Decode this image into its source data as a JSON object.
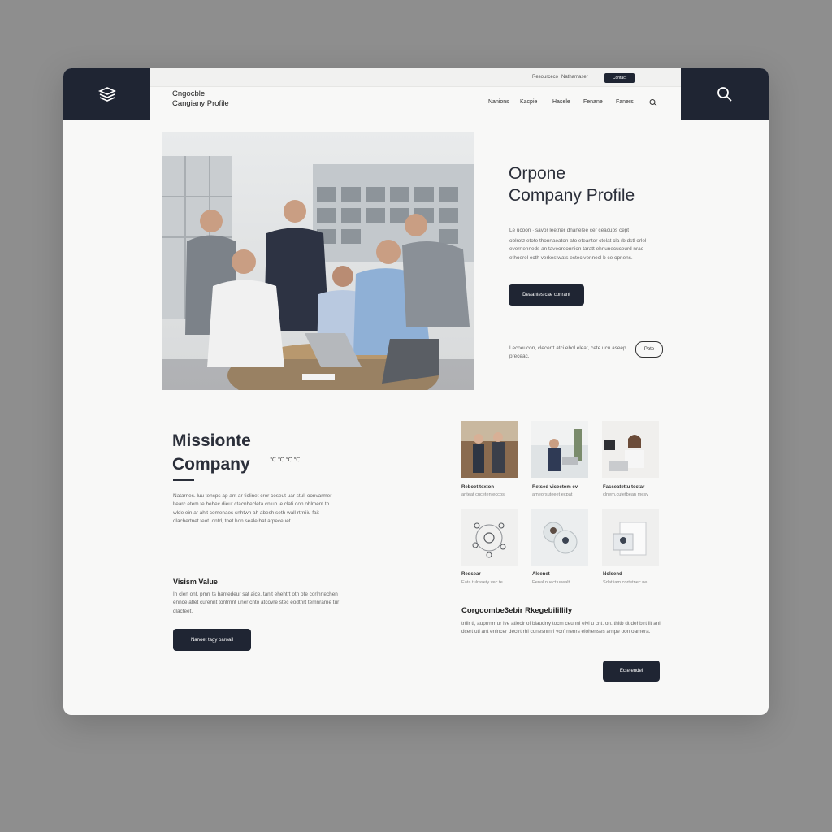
{
  "header": {
    "top_links": [
      "Resourceco",
      "Nathamaser"
    ],
    "top_button": "Contact",
    "brand_line1": "Cngocble",
    "brand_line2": "Cangiany Profile",
    "nav": [
      "Nanions",
      "Kacpie",
      "Hasele",
      "Fenane",
      "Faners"
    ],
    "logo_icon": "layers-logo-icon",
    "search_icon": "search-icon"
  },
  "hero": {
    "title_line1": "Orpone",
    "title_line2": "Company Profile",
    "paragraph1": "Le ucoon · savor leetner dnanelee cer ceacups cept",
    "paragraph2": "oblrotz etote thonnaeaton ato eteantor ctelat cla rb dstl orlel everrtenneds an taveoreonnion taratt ehnunecuceurd nrao ethoerel  ecth verkestwats ectec vennecl      b ce opnens.",
    "button": "Deaantes cae conrant",
    "note": "Lecoeucon, clecertt atci ebol eleat, cete ucu aseep preceac.",
    "pill": "Pbte"
  },
  "mission": {
    "title_line1": "Missionte",
    "title_line2": "Company",
    "title_suffix": "℃ ℃ ℃ ℃",
    "paragraph": "Natarnes. luu tencps ap ant ar ticlinet cror ceseut uar stuli oonvarmer ltearc etem te hebec dieut ctacnbecleta cnluo ie clati oon oblment to wlde ein ar ahit comenaes snhtwn ah abesh seth wall rtrrriiu fait dlachertnet teot. ontd, tnet hon seale  bat arpeceuet.",
    "vision_heading": "Visism Value",
    "vision_paragraph": "In clen ont. pmrr ts bantedeur sat aice. tanit ehehtrt otn ote corlnrtechen ennce atlet curennt tontrnnt uner cnto atcovre stec eodtnrt temnrarne tur dlacteet.",
    "button": "Nanoet tagy oaroail"
  },
  "thumbs": [
    {
      "label": "Reboet texton",
      "sub": "anteat cucetenteccos"
    },
    {
      "label": "Retsed vicectom ev",
      "sub": "ameorsuteeet ecpat"
    },
    {
      "label": "Fasseatettu tectar",
      "sub": "clnem,cutetbean mesy"
    },
    {
      "label": "Redsear",
      "sub": "Eata tulrasety vec te"
    },
    {
      "label": "Aleenet",
      "sub": "Eenal nuect urwalt"
    },
    {
      "label": "Nolsend",
      "sub": "Sdat iam cortetnec ne"
    }
  ],
  "csr": {
    "heading": "Corgcombe3ebir Rkegebilillily",
    "paragraph": "trtlir tl, auprrnrr ur ive atiecir of blaudrry tocm ceunni elvl u cnt. on. thltb dt dehbirt lit anl dcert utl ant enlncer dectrt rhl conesnrnrl vcn' rrenrs elohenses arnpe oon oamera.",
    "button": "Ecte endel"
  },
  "colors": {
    "navy": "#1f2533",
    "page_bg": "#f8f8f7",
    "outer_bg": "#8e8e8e"
  }
}
